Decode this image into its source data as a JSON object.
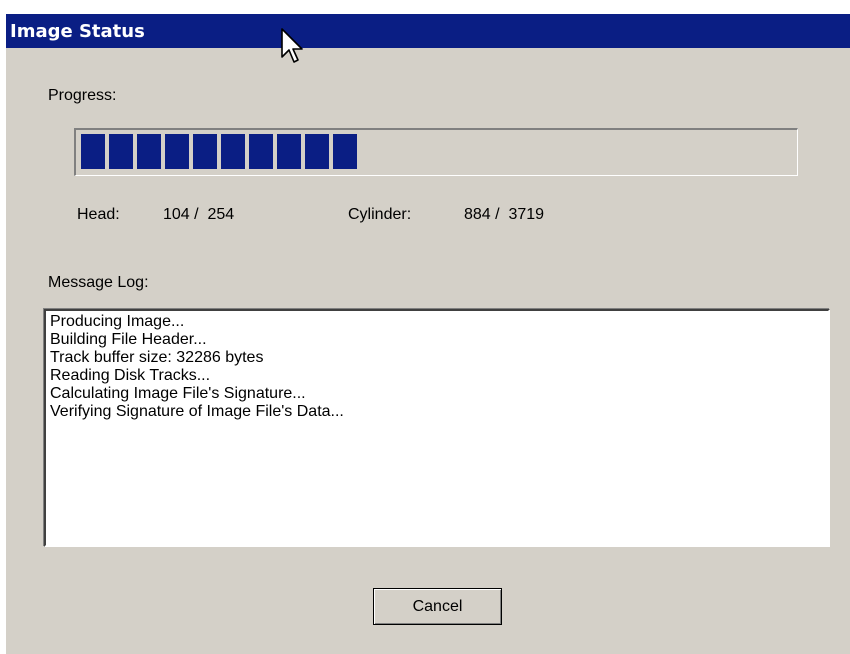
{
  "window": {
    "title": "Image Status"
  },
  "progress": {
    "label": "Progress:",
    "fraction": 0.39
  },
  "head": {
    "label": "Head:",
    "value": "104 /  254"
  },
  "cylinder": {
    "label": "Cylinder:",
    "value": "884 /  3719"
  },
  "log": {
    "label": "Message Log:",
    "lines": [
      "Producing Image...",
      "Building File Header...",
      "Track buffer size: 32286 bytes",
      "Reading Disk Tracks...",
      "Calculating Image File's Signature...",
      "Verifying Signature of Image File's Data..."
    ]
  },
  "buttons": {
    "cancel": "Cancel"
  },
  "colors": {
    "titlebar": "#0a1e84",
    "face": "#d4d0c8",
    "progress_fill": "#0a1e84"
  }
}
